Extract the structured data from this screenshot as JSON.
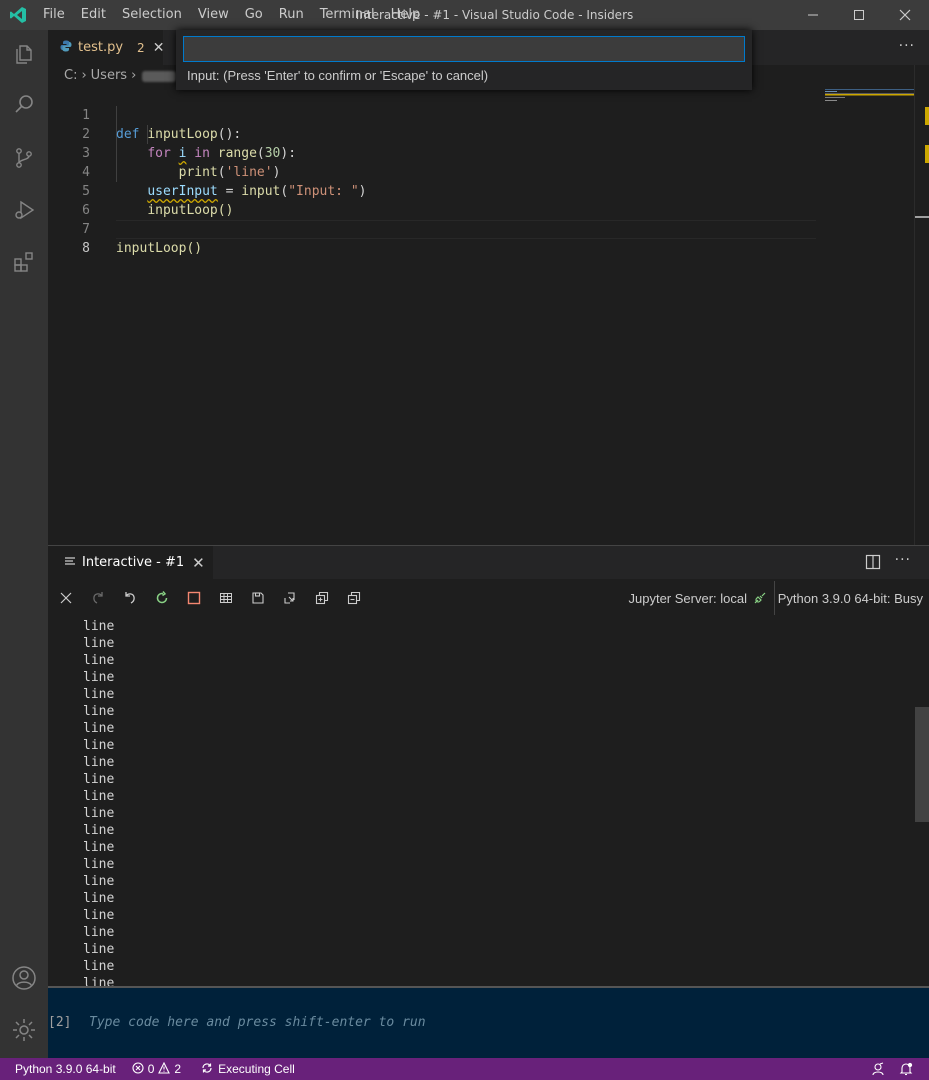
{
  "titlebar": {
    "menu": [
      "File",
      "Edit",
      "Selection",
      "View",
      "Go",
      "Run",
      "Terminal",
      "Help"
    ],
    "title": "Interactive - #1 - Visual Studio Code - Insiders"
  },
  "editor_tabs": [
    {
      "label": "test.py",
      "problems": "2",
      "modified_color": "#e2c08d"
    }
  ],
  "breadcrumb": {
    "drive": "C:",
    "folder": "Users"
  },
  "code_lines": [
    {
      "n": "1"
    },
    {
      "n": "2"
    },
    {
      "n": "3"
    },
    {
      "n": "4"
    },
    {
      "n": "5"
    },
    {
      "n": "6"
    },
    {
      "n": "7"
    },
    {
      "n": "8"
    }
  ],
  "code": {
    "l1": {
      "kw": "def",
      "fn": "inputLoop",
      "rest": "():"
    },
    "l2": {
      "kw": "for",
      "var": "i",
      "in": "in",
      "fn": "range",
      "num": "30",
      "rest": "):"
    },
    "l3": {
      "fn": "print",
      "str": "'line'",
      "rest": ")"
    },
    "l4": {
      "var": "userInput",
      "op": " = ",
      "fn": "input",
      "str": "\"Input: \"",
      "rest": ")"
    },
    "l5": {
      "text": "inputLoop()"
    },
    "l7": {
      "text": "inputLoop()"
    }
  },
  "quick_input": {
    "value": "",
    "placeholder": "",
    "message": "Input: (Press 'Enter' to confirm or 'Escape' to cancel)"
  },
  "panel": {
    "tab_label": "Interactive - #1",
    "jupyter_server": "Jupyter Server: local",
    "kernel": "Python 3.9.0 64-bit: Busy"
  },
  "output_lines": [
    "line",
    "line",
    "line",
    "line",
    "line",
    "line",
    "line",
    "line",
    "line",
    "line",
    "line",
    "line",
    "line",
    "line",
    "line",
    "line",
    "line",
    "line",
    "line",
    "line",
    "line",
    "line"
  ],
  "cell_input": {
    "number": "[2]",
    "placeholder": "Type code here and press shift-enter to run"
  },
  "statusbar": {
    "interpreter": "Python 3.9.0 64-bit",
    "errors": "0",
    "warnings": "2",
    "activity": "Executing Cell",
    "background_color": "#68217a"
  },
  "icons": {
    "activity": [
      "explorer-icon",
      "search-icon",
      "source-control-icon",
      "run-debug-icon",
      "extensions-icon",
      "account-icon",
      "manage-gear-icon"
    ]
  }
}
